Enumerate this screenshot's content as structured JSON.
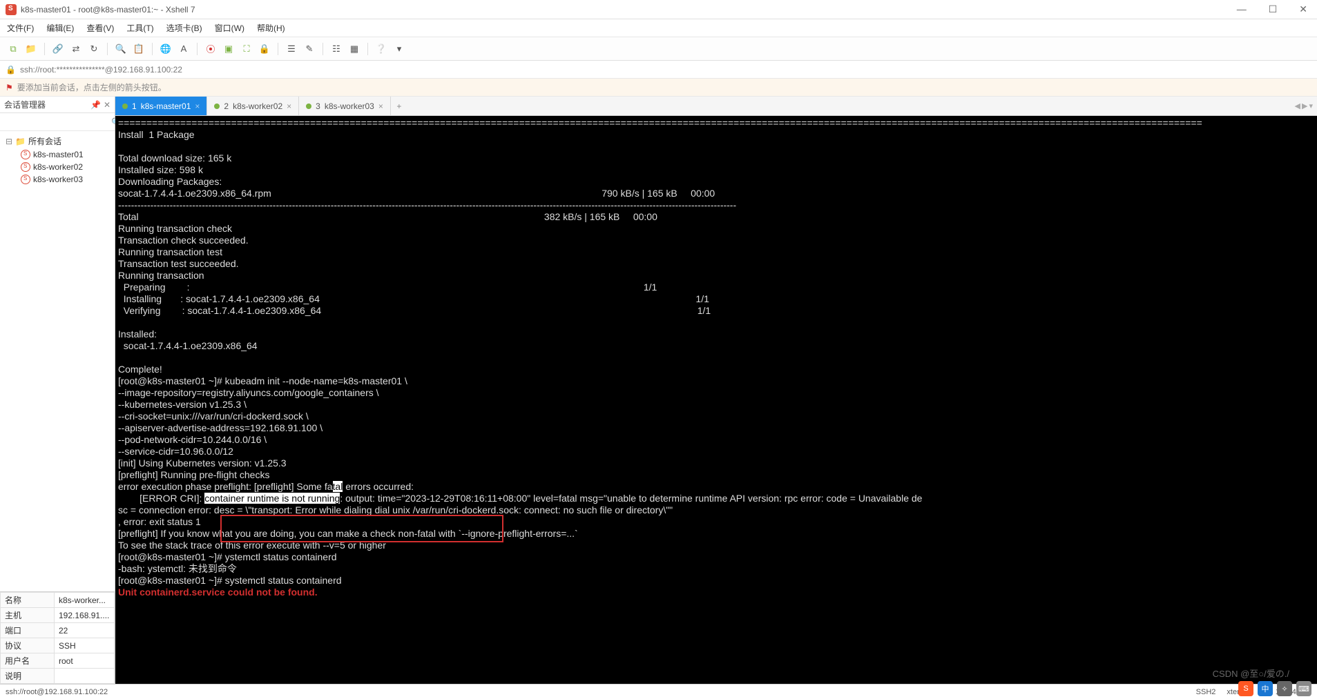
{
  "window": {
    "title": "k8s-master01 - root@k8s-master01:~ - Xshell 7",
    "minimize": "—",
    "maximize": "☐",
    "close": "✕"
  },
  "menu": {
    "file": "文件(F)",
    "edit": "编辑(E)",
    "view": "查看(V)",
    "tools": "工具(T)",
    "tabs": "选项卡(B)",
    "window": "窗口(W)",
    "help": "帮助(H)"
  },
  "address": "ssh://root:***************@192.168.91.100:22",
  "hint": "要添加当前会话，点击左侧的箭头按钮。",
  "session_manager": {
    "title": "会话管理器",
    "root": "所有会话",
    "items": [
      "k8s-master01",
      "k8s-worker02",
      "k8s-worker03"
    ]
  },
  "props": {
    "name_label": "名称",
    "name_val": "k8s-worker...",
    "host_label": "主机",
    "host_val": "192.168.91....",
    "port_label": "端口",
    "port_val": "22",
    "proto_label": "协议",
    "proto_val": "SSH",
    "user_label": "用户名",
    "user_val": "root",
    "desc_label": "说明",
    "desc_val": ""
  },
  "tabs": {
    "t1": {
      "num": "1",
      "label": "k8s-master01"
    },
    "t2": {
      "num": "2",
      "label": "k8s-worker02"
    },
    "t3": {
      "num": "3",
      "label": "k8s-worker03"
    }
  },
  "terminal": {
    "line_sep": "================================================================================================================================================================================================",
    "l1": "Install  1 Package",
    "l2": "",
    "l3": "Total download size: 165 k",
    "l4": "Installed size: 598 k",
    "l5": "Downloading Packages:",
    "l6": "socat-1.7.4.4-1.oe2309.x86_64.rpm                                                                                                                           790 kB/s | 165 kB     00:00",
    "dash": "------------------------------------------------------------------------------------------------------------------------------------------------------------------------------------------------",
    "l7": "Total                                                                                                                                                       382 kB/s | 165 kB     00:00",
    "l8": "Running transaction check",
    "l9": "Transaction check succeeded.",
    "l10": "Running transaction test",
    "l11": "Transaction test succeeded.",
    "l12": "Running transaction",
    "l13": "  Preparing        :                                                                                                                                                                         1/1",
    "l14": "  Installing       : socat-1.7.4.4-1.oe2309.x86_64                                                                                                                                            1/1",
    "l15": "  Verifying        : socat-1.7.4.4-1.oe2309.x86_64                                                                                                                                            1/1",
    "l16": "",
    "l17": "Installed:",
    "l18": "  socat-1.7.4.4-1.oe2309.x86_64",
    "l19": "",
    "l20": "Complete!",
    "l21": "[root@k8s-master01 ~]# kubeadm init --node-name=k8s-master01 \\",
    "l22": "--image-repository=registry.aliyuncs.com/google_containers \\",
    "l23": "--kubernetes-version v1.25.3 \\",
    "l24": "--cri-socket=unix:///var/run/cri-dockerd.sock \\",
    "l25": "--apiserver-advertise-address=192.168.91.100 \\",
    "l26": "--pod-network-cidr=10.244.0.0/16 \\",
    "l27": "--service-cidr=10.96.0.0/12",
    "l28": "[init] Using Kubernetes version: v1.25.3",
    "l29": "[preflight] Running pre-flight checks",
    "l30a": "error execution phase preflight: [preflight] Some fa",
    "l30hl": "tal",
    "l30b": " errors occurred:",
    "l31a": "        [ERROR CRI]: ",
    "l31hl": "container runtime is not running",
    "l31b": ": output: time=\"2023-12-29T08:16:11+08:00\" level=fatal msg=\"unable to determine runtime API version: rpc error: code = Unavailable de",
    "l32": "sc = connection error: desc = \\\"transport: Error while dialing dial unix /var/run/cri-dockerd.sock: connect: no such file or directory\\\"\"",
    "l33": ", error: exit status 1",
    "l34": "[preflight] If you know what you are doing, you can make a check non-fatal with `--ignore-preflight-errors=...`",
    "l35": "To see the stack trace of this error execute with --v=5 or higher",
    "l36": "[root@k8s-master01 ~]# ystemctl status containerd",
    "l37": "-bash: ystemctl: 未找到命令",
    "l38": "[root@k8s-master01 ~]# systemctl status containerd",
    "l39": "Unit containerd.service could not be found."
  },
  "status": {
    "left": "ssh://root@192.168.91.100:22",
    "ssh": "SSH2",
    "term": "xterm",
    "size": "186x41",
    "extra1": "",
    "extra2": ""
  },
  "watermark": "CSDN @至○/爱の./"
}
